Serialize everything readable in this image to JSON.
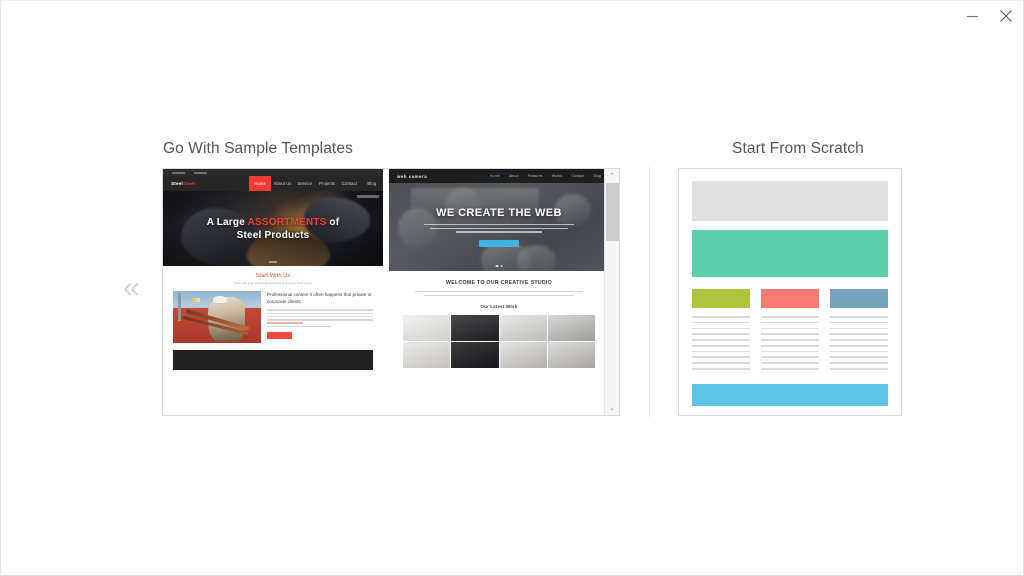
{
  "window": {
    "controls": [
      {
        "name": "minimize",
        "glyph": "—",
        "label": "Minimize"
      },
      {
        "name": "close",
        "glyph": "✕",
        "label": "Close"
      }
    ]
  },
  "sections": {
    "samples": {
      "title": "Go With Sample Templates"
    },
    "scratch": {
      "title": "Start From Scratch"
    }
  },
  "nav": {
    "prev_glyph": "«",
    "prev_label": "Previous templates"
  },
  "scrollbar": {
    "up_glyph": "⌃",
    "down_glyph": "⌄"
  },
  "templates": [
    {
      "id": "steel-products",
      "logo_prefix": "Steel",
      "logo_suffix": "Steel",
      "nav_items": [
        "Home",
        "About Us",
        "Service",
        "Projects",
        "Contact",
        "Blog"
      ],
      "active_nav": "Home",
      "hero_line1_a": "A Large ",
      "hero_line1_b": "ASSORTMENTS",
      "hero_line1_c": " of",
      "hero_line2": "Steel Products",
      "section_heading": "Start With Us",
      "section_sub": "Travel with great elegant and beautiful architecture from expert.",
      "body_heading": "Professional context it often happens that private or corporate clients",
      "accent_color": "#ee3b33"
    },
    {
      "id": "web-studio",
      "logo": "web camera",
      "nav_items": [
        "Home",
        "About",
        "Features",
        "Works",
        "Contact",
        "Blog"
      ],
      "active_nav": "Home",
      "hero_heading": "WE CREATE THE WEB",
      "section_heading": "WELCOME TO OUR CREATIVE STUDIO",
      "gallery_heading": "Our Latest Work",
      "accent_color": "#3fb3e3"
    }
  ],
  "scratch_wireframe": {
    "header_color": "#e0e0e0",
    "hero_color": "#5acfac",
    "chip_colors": [
      "#aec43c",
      "#fa7a72",
      "#76a2bc"
    ],
    "footer_color": "#5bc5e5",
    "line_color": "#dcdcdc",
    "columns": 3,
    "lines_per_column": 10
  }
}
